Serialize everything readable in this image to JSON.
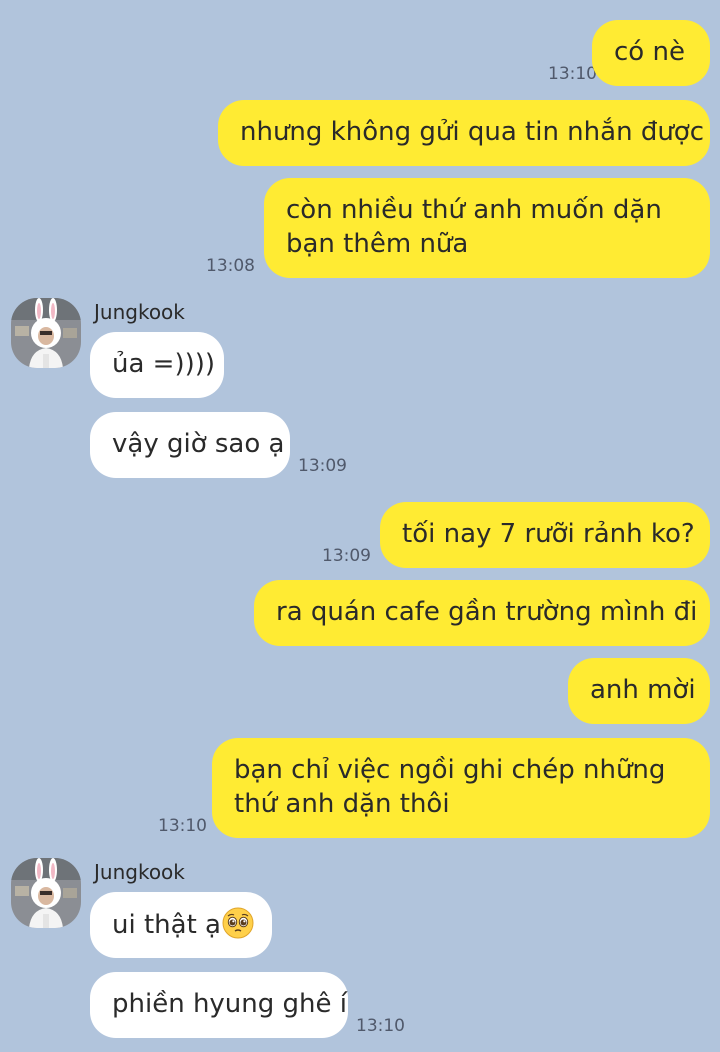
{
  "conversation": {
    "messages": [
      {
        "from": "me",
        "text": "có nè"
      },
      {
        "from": "me",
        "text": "nhưng không gửi qua tin nhắn được"
      },
      {
        "from": "me",
        "text": "còn nhiều thứ anh muốn dặn bạn thêm nữa"
      },
      {
        "from": "Jungkook",
        "text": "ủa =))))"
      },
      {
        "from": "Jungkook",
        "text": "vậy giờ sao ạ"
      },
      {
        "from": "me",
        "text": "tối nay 7 rưỡi rảnh ko?"
      },
      {
        "from": "me",
        "text": "ra quán cafe gần trường mình đi"
      },
      {
        "from": "me",
        "text": "anh mời"
      },
      {
        "from": "me",
        "text": "bạn chỉ việc ngồi ghi chép những thứ anh dặn thôi"
      },
      {
        "from": "Jungkook",
        "text": "ui thật ạ",
        "emoji": "pleading-face"
      },
      {
        "from": "Jungkook",
        "text": "phiền hyung ghê í"
      }
    ],
    "timestamps": [
      "13:10",
      "13:08",
      "13:09",
      "13:09",
      "13:10",
      "13:10"
    ],
    "sender_names": [
      "Jungkook",
      "Jungkook"
    ]
  },
  "colors": {
    "background": "#b1c4dc",
    "outgoing_bubble": "#ffeb33",
    "incoming_bubble": "#ffffff"
  }
}
